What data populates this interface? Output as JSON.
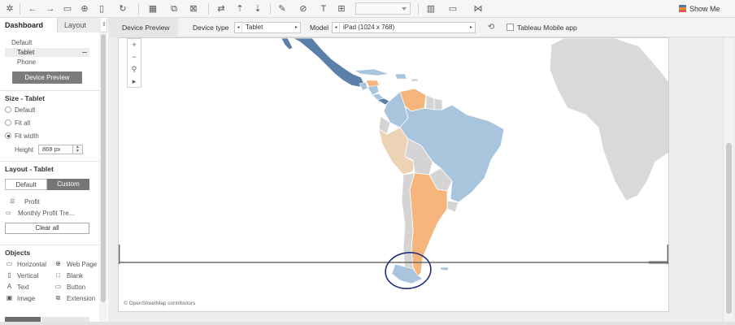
{
  "toolbar": {
    "icons": [
      "tableau-logo-icon",
      "undo-icon",
      "redo-icon",
      "save-icon",
      "new-datasource-icon",
      "pause-updates-icon",
      "refresh-icon",
      "new-worksheet-icon",
      "duplicate-icon",
      "clear-sheet-icon",
      "swap-icon",
      "sort-asc-icon",
      "sort-desc-icon",
      "highlight-icon",
      "group-icon",
      "labels-icon",
      "fix-axes-icon",
      "fit-dropdown",
      "show-cards-icon",
      "presentation-icon",
      "share-icon"
    ],
    "show_me_label": "Show Me"
  },
  "sidebar": {
    "tabs": {
      "dashboard": "Dashboard",
      "layout": "Layout"
    },
    "device_list": [
      "Default",
      "Tablet",
      "Phone"
    ],
    "device_preview_button": "Device Preview",
    "size_heading": "Size - Tablet",
    "size_options": [
      "Default",
      "Fit all",
      "Fit width"
    ],
    "height_label": "Height",
    "height_value": "868 px",
    "layout_heading": "Layout - Tablet",
    "layout_default": "Default",
    "layout_custom": "Custom",
    "sheets": [
      "Profit",
      "Monthly Profit Tre..."
    ],
    "clear_all": "Clear all",
    "objects_heading": "Objects",
    "objects": [
      {
        "label": "Horizontal",
        "icon": "horizontal-container-icon"
      },
      {
        "label": "Web Page",
        "icon": "globe-icon"
      },
      {
        "label": "Vertical",
        "icon": "vertical-container-icon"
      },
      {
        "label": "Blank",
        "icon": "blank-icon"
      },
      {
        "label": "Text",
        "icon": "text-icon"
      },
      {
        "label": "Button",
        "icon": "button-icon"
      },
      {
        "label": "Image",
        "icon": "image-icon"
      },
      {
        "label": "Extension",
        "icon": "extension-icon"
      }
    ]
  },
  "device_bar": {
    "title": "Device Preview",
    "device_type_label": "Device type",
    "device_type_value": "Tablet",
    "model_label": "Model",
    "model_value": "iPad (1024 x 768)",
    "mobile_app_label": "Tableau Mobile app"
  },
  "map": {
    "credit": "© OpenStreetMap contributors",
    "colors": {
      "dark_blue": "#5b7fa9",
      "light_blue": "#a9c4dd",
      "orange": "#f5b57c",
      "tan": "#ecd3b6",
      "grey": "#d4d4d4",
      "annotation": "#22317a"
    }
  }
}
